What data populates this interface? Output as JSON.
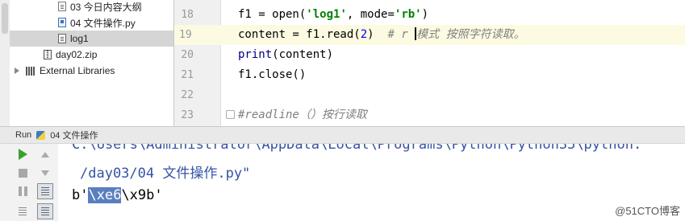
{
  "project_tree": {
    "items": [
      {
        "label": "03 今日内容大纲",
        "icon": "text-file-icon"
      },
      {
        "label": "04 文件操作.py",
        "icon": "python-file-icon"
      },
      {
        "label": "log1",
        "icon": "text-file-icon",
        "selected": true
      },
      {
        "label": "day02.zip",
        "icon": "zip-file-icon"
      },
      {
        "label": "External Libraries",
        "icon": "library-icon"
      }
    ]
  },
  "editor": {
    "lines": [
      {
        "number": "18",
        "text": "f1 = open('log1', mode='rb')"
      },
      {
        "number": "19",
        "code": "content = f1.read(2)",
        "comment": "# r 模式 按照字符读取。",
        "current": true
      },
      {
        "number": "20",
        "text": "print(content)"
      },
      {
        "number": "21",
        "text": "f1.close()"
      },
      {
        "number": "22",
        "text": ""
      },
      {
        "number": "23",
        "text": "#readline（）按行读取"
      }
    ]
  },
  "run_panel": {
    "label": "Run",
    "config_name": "04 文件操作",
    "console": {
      "command_line_1": "C:\\Users\\Administrator\\AppData\\Local\\Programs\\Python\\Python35\\python.",
      "command_line_2": "/day03/04 文件操作.py\"",
      "output_prefix": "b'",
      "output_selected": "\\xe6",
      "output_suffix": "\\x9b'"
    }
  },
  "watermark": "@51CTO博客",
  "colors": {
    "selection": "#5a7fbf",
    "current_line": "#fcfbe2",
    "string": "#008000",
    "number": "#0000ff",
    "comment": "#808080",
    "run_green": "#3aa22b"
  }
}
